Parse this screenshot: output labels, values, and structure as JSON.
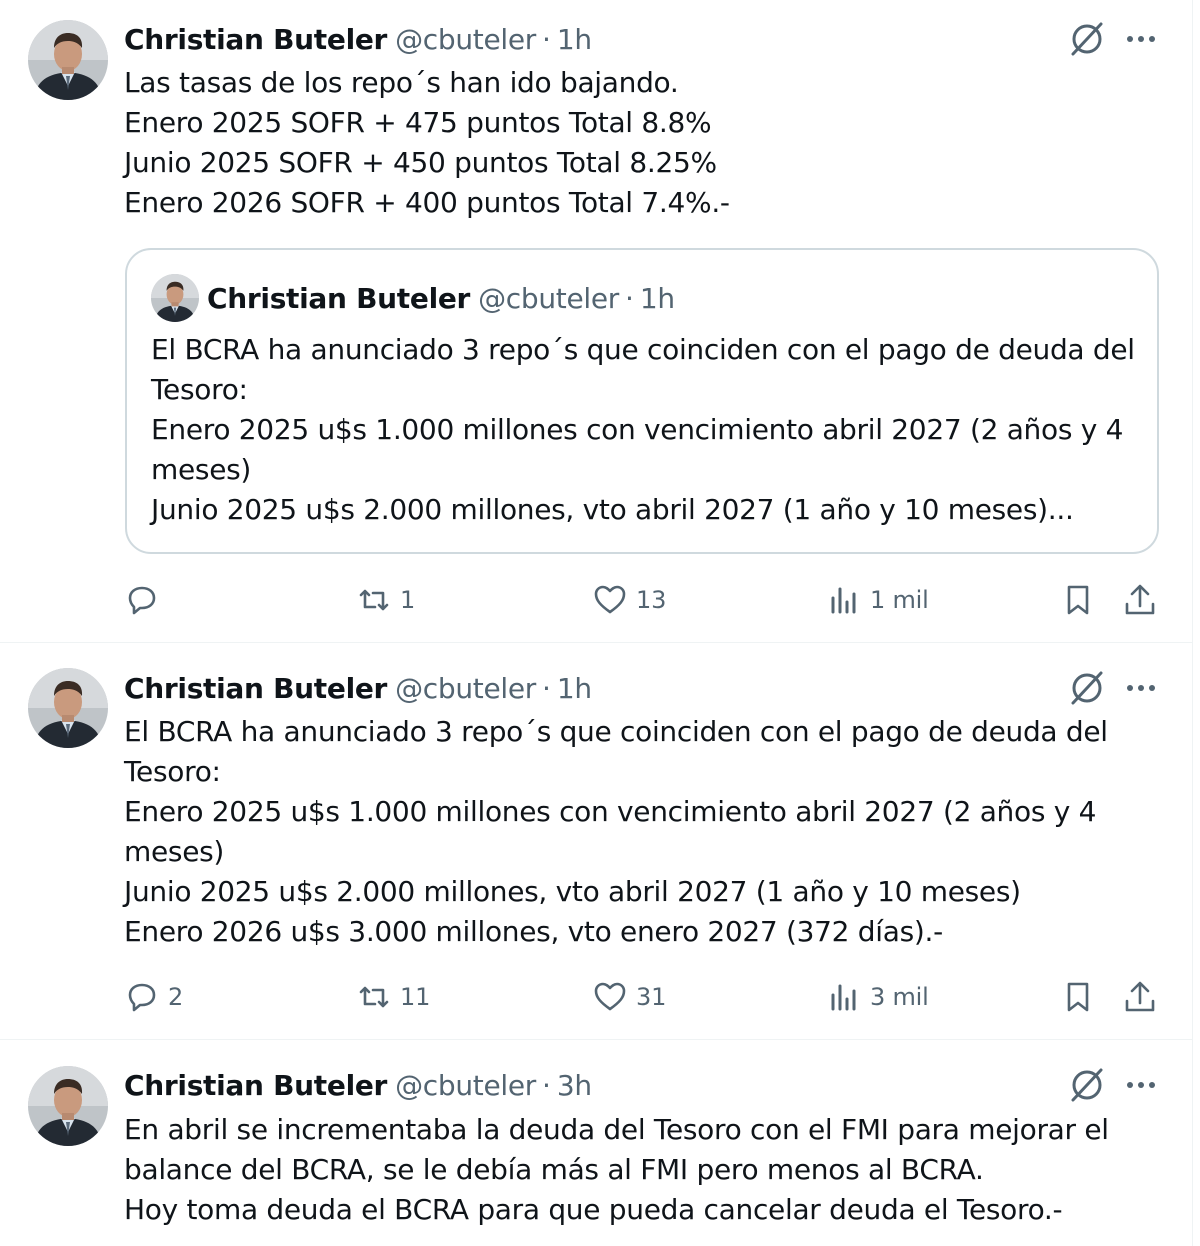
{
  "author": {
    "name": "Christian Buteler",
    "handle": "@cbuteler",
    "separator": "·"
  },
  "tweets": [
    {
      "time": "1h",
      "lines": [
        "Las tasas de los repo´s han ido bajando.",
        "Enero 2025 SOFR + 475 puntos Total 8.8%",
        "Junio 2025 SOFR + 450 puntos Total 8.25%",
        "Enero 2026 SOFR + 400 puntos Total 7.4%.-"
      ],
      "quote": {
        "time": "1h",
        "lines": [
          "El BCRA ha anunciado 3 repo´s que coinciden con el pago de deuda del",
          "Tesoro:",
          "Enero 2025 u$s 1.000 millones con vencimiento abril 2027 (2 años y 4",
          "meses)",
          "Junio 2025 u$s 2.000 millones, vto abril 2027 (1 año y 10 meses)..."
        ]
      },
      "stats": {
        "replies": "",
        "reposts": "1",
        "likes": "13",
        "views": "1 mil"
      }
    },
    {
      "time": "1h",
      "lines": [
        "El BCRA ha anunciado 3 repo´s que coinciden con el pago de deuda del",
        "Tesoro:",
        "Enero 2025 u$s 1.000 millones con vencimiento abril 2027 (2 años y 4",
        "meses)",
        "Junio 2025 u$s 2.000 millones, vto abril 2027 (1 año y 10 meses)",
        "Enero 2026 u$s 3.000 millones, vto enero 2027 (372 días).-"
      ],
      "stats": {
        "replies": "2",
        "reposts": "11",
        "likes": "31",
        "views": "3 mil"
      }
    },
    {
      "time": "3h",
      "lines": [
        "En abril se incrementaba la deuda del Tesoro con el FMI para mejorar el",
        "balance del BCRA, se le debía más al FMI pero menos al BCRA.",
        "Hoy toma deuda el BCRA para que pueda cancelar deuda el Tesoro.-"
      ]
    }
  ],
  "icons": {
    "grok": "grok-icon",
    "more": "more-icon",
    "reply": "reply-icon",
    "repost": "repost-icon",
    "like": "like-icon",
    "views": "views-icon",
    "bookmark": "bookmark-icon",
    "share": "share-icon"
  },
  "colors": {
    "text": "#0f1419",
    "muted": "#536471",
    "border": "#cfd9de",
    "divider": "#eff3f4"
  }
}
